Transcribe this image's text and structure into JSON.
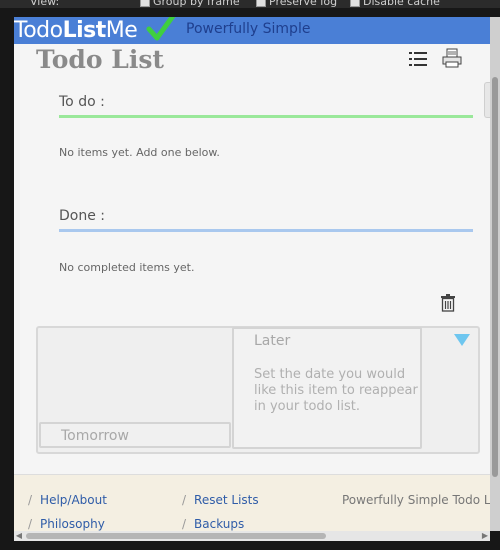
{
  "devtools": {
    "items": [
      "View:",
      "Group by frame",
      "Preserve log",
      "Disable cache"
    ]
  },
  "header": {
    "logo_prefix": "Todo",
    "logo_mid": "List",
    "logo_suffix": "Me",
    "tagline": "Powerfully Simple",
    "accent_color": "#4a7fd6",
    "check_color": "#3fcf3f"
  },
  "list": {
    "title": "Todo List",
    "sort_icon": "list-sort-icon",
    "print_icon": "print-icon"
  },
  "todo_section": {
    "label": "To do :",
    "line_color": "#9ae89a",
    "empty_text": "No items yet. Add one below."
  },
  "done_section": {
    "label": "Done :",
    "line_color": "#a9c8ee",
    "empty_text": "No completed items yet."
  },
  "trash_icon": "trash-icon",
  "scheduler": {
    "later_title": "Later",
    "later_description": "Set the date you would like this item to reappear in your todo list.",
    "tomorrow_label": "Tomorrow",
    "triangle_color": "#6ec6ef"
  },
  "footer": {
    "links": [
      "Help/About",
      "Philosophy",
      "Reset Lists",
      "Backups"
    ],
    "tagline": "Powerfully Simple Todo Lists"
  }
}
